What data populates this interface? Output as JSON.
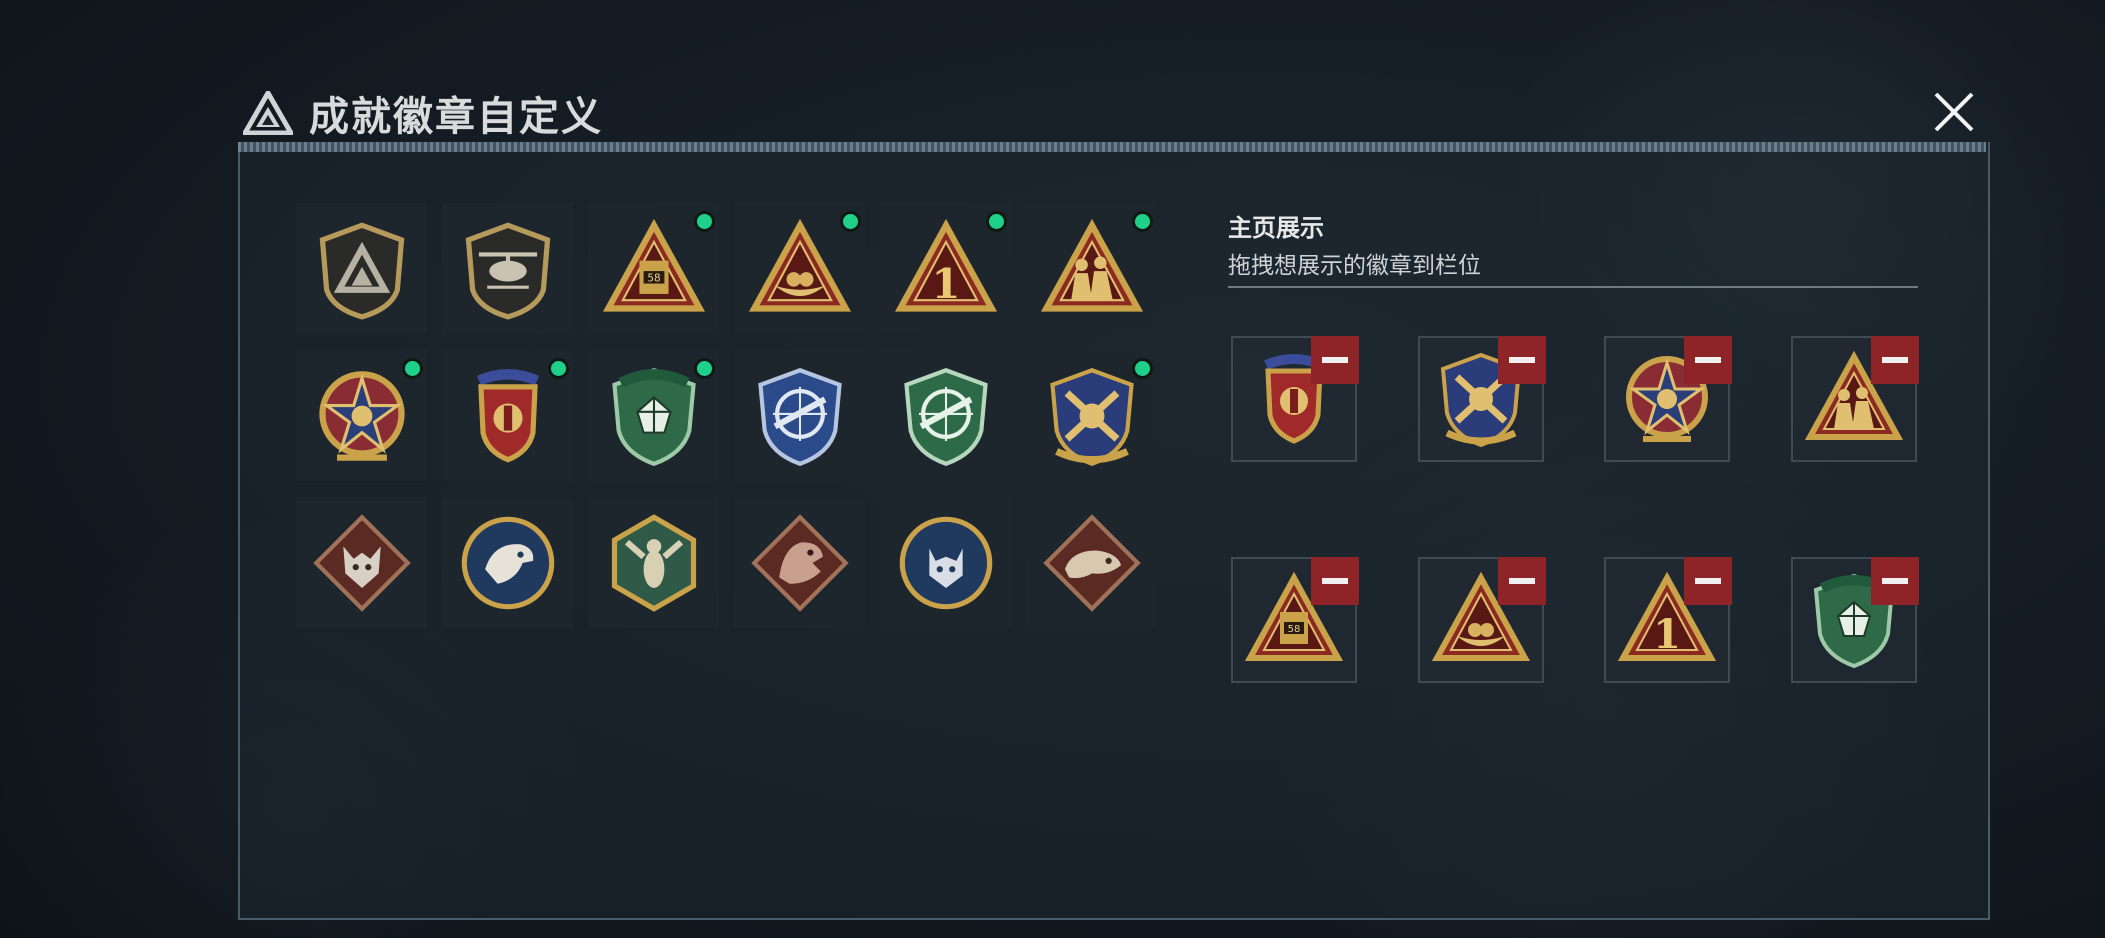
{
  "header": {
    "title": "成就徽章自定义"
  },
  "side": {
    "title": "主页展示",
    "subtitle": "拖拽想展示的徽章到栏位"
  },
  "badge_grid": [
    {
      "icon": "triangle-logo-shield-badge",
      "new": false
    },
    {
      "icon": "helicopter-shield-badge",
      "new": false
    },
    {
      "icon": "vehicle-58-triangle-badge",
      "new": true,
      "text": "58"
    },
    {
      "icon": "nest-triangle-badge",
      "new": true
    },
    {
      "icon": "number-one-triangle-badge",
      "new": true,
      "text": "1"
    },
    {
      "icon": "soldiers-triangle-badge",
      "new": true
    },
    {
      "icon": "star-medal-badge",
      "new": true
    },
    {
      "icon": "stars-crest-badge",
      "new": true
    },
    {
      "icon": "green-gem-shield-badge",
      "new": true
    },
    {
      "icon": "blue-sniper-shield-badge",
      "new": false
    },
    {
      "icon": "green-sniper-shield-badge",
      "new": false
    },
    {
      "icon": "gold-crossed-crest-badge",
      "new": true
    },
    {
      "icon": "wolf-diamond-badge",
      "new": false
    },
    {
      "icon": "eagle-circle-badge",
      "new": false
    },
    {
      "icon": "hornet-hexagon-badge",
      "new": false
    },
    {
      "icon": "dragon-diamond-badge",
      "new": false
    },
    {
      "icon": "lynx-circle-badge",
      "new": false
    },
    {
      "icon": "komodo-diamond-badge",
      "new": false
    }
  ],
  "display_slots": [
    {
      "icon": "stars-crest-badge"
    },
    {
      "icon": "gold-crossed-crest-badge"
    },
    {
      "icon": "star-medal-badge"
    },
    {
      "icon": "soldiers-triangle-badge"
    },
    {
      "icon": "vehicle-58-triangle-badge",
      "text": "58"
    },
    {
      "icon": "nest-triangle-badge"
    },
    {
      "icon": "number-one-triangle-badge",
      "text": "1"
    },
    {
      "icon": "green-gem-shield-badge"
    }
  ],
  "colors": {
    "gold": "#c9a24a",
    "red": "#8e2328",
    "green": "#1fd08a",
    "panel": "#1e262d"
  }
}
